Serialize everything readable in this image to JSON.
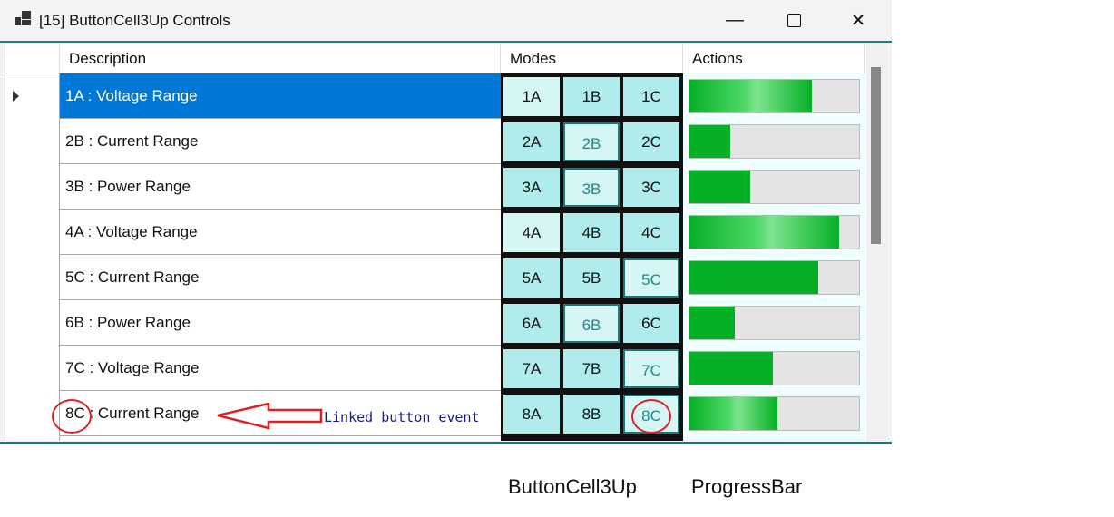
{
  "window": {
    "title": "[15] ButtonCell3Up Controls"
  },
  "columns": {
    "description": "Description",
    "modes": "Modes",
    "actions": "Actions"
  },
  "rows": [
    {
      "description": "1A : Voltage Range",
      "buttons": [
        "1A",
        "1B",
        "1C"
      ],
      "active": 0,
      "teal": false,
      "progress": 72,
      "glow": true,
      "selected": true
    },
    {
      "description": "2B : Current Range",
      "buttons": [
        "2A",
        "2B",
        "2C"
      ],
      "active": 1,
      "teal": true,
      "progress": 24,
      "glow": false
    },
    {
      "description": "3B : Power Range",
      "buttons": [
        "3A",
        "3B",
        "3C"
      ],
      "active": 1,
      "teal": true,
      "progress": 36,
      "glow": false
    },
    {
      "description": "4A : Voltage Range",
      "buttons": [
        "4A",
        "4B",
        "4C"
      ],
      "active": 0,
      "teal": false,
      "progress": 88,
      "glow": true
    },
    {
      "description": "5C : Current Range",
      "buttons": [
        "5A",
        "5B",
        "5C"
      ],
      "active": 2,
      "teal": true,
      "progress": 76,
      "glow": false
    },
    {
      "description": "6B : Power Range",
      "buttons": [
        "6A",
        "6B",
        "6C"
      ],
      "active": 1,
      "teal": true,
      "progress": 27,
      "glow": false
    },
    {
      "description": "7C : Voltage Range",
      "buttons": [
        "7A",
        "7B",
        "7C"
      ],
      "active": 2,
      "teal": true,
      "progress": 49,
      "glow": false
    },
    {
      "description": "8C : Current Range",
      "buttons": [
        "8A",
        "8B",
        "8C"
      ],
      "active": 2,
      "teal": true,
      "progress": 52,
      "glow": true
    }
  ],
  "annotation": "Linked button event",
  "labels": {
    "buttons": "ButtonCell3Up",
    "progress": "ProgressBar"
  }
}
